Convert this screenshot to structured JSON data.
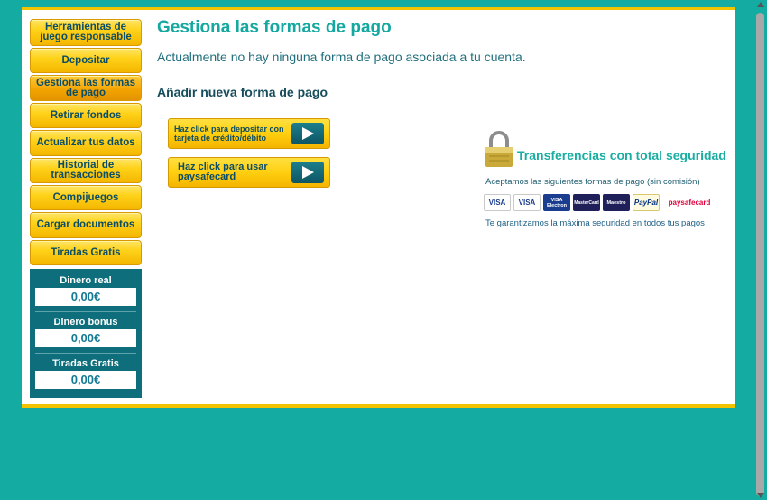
{
  "sidebar": {
    "items": [
      {
        "label": "Herramientas de juego responsable"
      },
      {
        "label": "Depositar"
      },
      {
        "label": "Gestiona las formas de pago"
      },
      {
        "label": "Retirar fondos"
      },
      {
        "label": "Actualizar tus datos"
      },
      {
        "label": "Historial de transacciones"
      },
      {
        "label": "Compijuegos"
      },
      {
        "label": "Cargar documentos"
      },
      {
        "label": "Tiradas Gratis"
      }
    ]
  },
  "balances": [
    {
      "label": "Dinero real",
      "value": "0,00€"
    },
    {
      "label": "Dinero bonus",
      "value": "0,00€"
    },
    {
      "label": "Tiradas Gratis",
      "value": "0,00€"
    }
  ],
  "main": {
    "title": "Gestiona las formas de pago",
    "subtitle": "Actualmente no hay ninguna forma de pago asociada a tu cuenta.",
    "section_title": "Añadir nueva forma de pago",
    "buttons": [
      {
        "label": "Haz click para depositar con tarjeta de crédito/débito"
      },
      {
        "label": "Haz click para usar paysafecard"
      }
    ]
  },
  "security": {
    "title": "Transferencias con total seguridad",
    "accept_text": "Aceptamos las siguientes formas de pago (sin comisión)",
    "cards": [
      {
        "label": "VISA",
        "icon": "visa-icon",
        "color": "#1a3d8f"
      },
      {
        "label": "VISA",
        "icon": "visa-icon",
        "color": "#1a3d8f"
      },
      {
        "label": "VISA Electron",
        "icon": "visa-electron-icon",
        "color": "#1a3d8f"
      },
      {
        "label": "MasterCard",
        "icon": "mastercard-icon",
        "color": "#e0461a"
      },
      {
        "label": "Maestro",
        "icon": "maestro-icon",
        "color": "#2b4ea2"
      },
      {
        "label": "PayPal",
        "icon": "paypal-icon",
        "color": "#003087"
      },
      {
        "label": "paysafecard",
        "icon": "paysafecard-icon",
        "color": "#e2003a"
      }
    ],
    "guarantee_text": "Te garantizamos la máxima seguridad en todos tus pagos"
  },
  "colors": {
    "background": "#14aba3",
    "accent": "#f3c300",
    "title": "#14a8a0",
    "balance_box": "#0e6e7b"
  }
}
